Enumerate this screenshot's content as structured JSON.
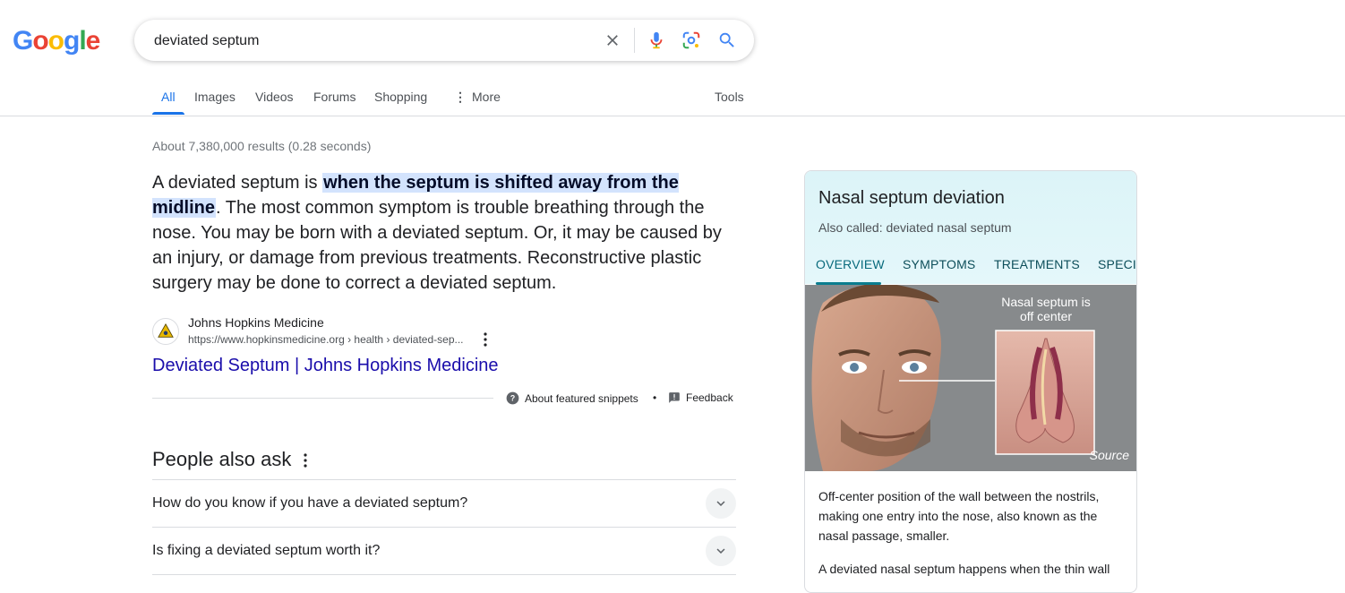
{
  "logo": {
    "letters": [
      "G",
      "o",
      "o",
      "g",
      "l",
      "e"
    ],
    "colors": [
      "#4285f4",
      "#ea4335",
      "#fbbc05",
      "#4285f4",
      "#34a853",
      "#ea4335"
    ]
  },
  "search": {
    "query": "deviated septum"
  },
  "tabs": [
    {
      "label": "All",
      "active": true
    },
    {
      "label": "Images"
    },
    {
      "label": "Videos"
    },
    {
      "label": "Forums"
    },
    {
      "label": "Shopping"
    },
    {
      "label": "More"
    }
  ],
  "tools_label": "Tools",
  "result_stats": "About 7,380,000 results (0.28 seconds)",
  "snippet": {
    "prefix": "A deviated septum is ",
    "highlight": "when the septum is shifted away from the midline",
    "suffix": ". The most common symptom is trouble breathing through the nose. You may be born with a deviated septum. Or, it may be caused by an injury, or damage from previous treatments. Reconstructive plastic surgery may be done to correct a deviated septum."
  },
  "source": {
    "name": "Johns Hopkins Medicine",
    "url": "https://www.hopkinsmedicine.org › health › deviated-sep...",
    "link_title": "Deviated Septum | Johns Hopkins Medicine"
  },
  "snippet_footer": {
    "about": "About featured snippets",
    "dot": "•",
    "feedback": "Feedback"
  },
  "paa": {
    "title": "People also ask",
    "questions": [
      "How do you know if you have a deviated septum?",
      "Is fixing a deviated septum worth it?"
    ]
  },
  "knowledge_panel": {
    "title": "Nasal septum deviation",
    "aka": "Also called: deviated nasal septum",
    "tabs": [
      "OVERVIEW",
      "SYMPTOMS",
      "TREATMENTS",
      "SPECIA"
    ],
    "image_caption": "Nasal septum is off center",
    "image_source": "Source",
    "description": "Off-center position of the wall between the nostrils, making one entry into the nose, also known as the nasal passage, smaller.",
    "description2": "A deviated nasal septum happens when the thin wall"
  }
}
